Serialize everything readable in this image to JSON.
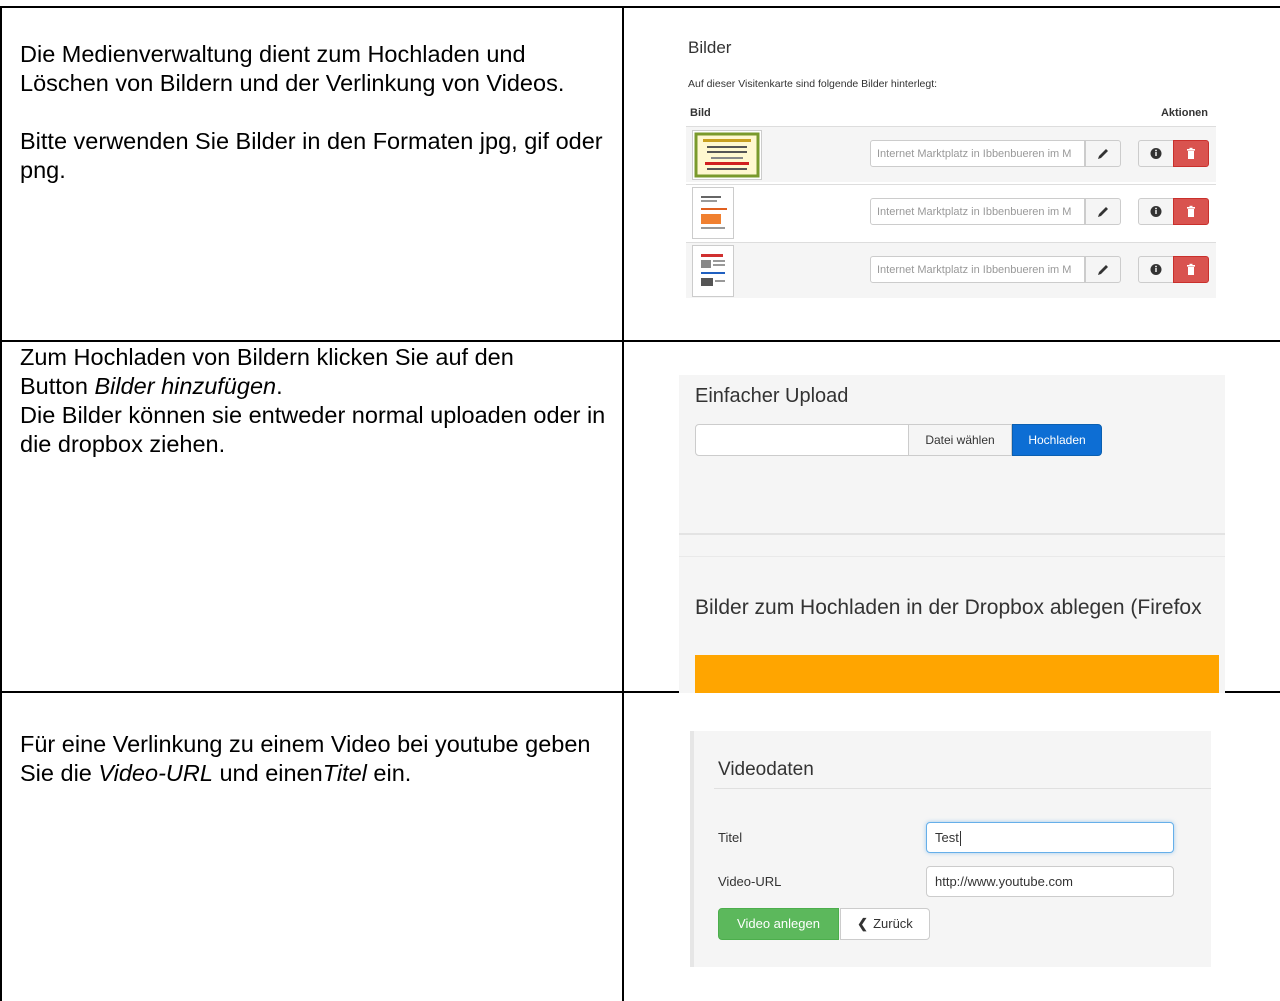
{
  "doc": {
    "row1": {
      "paragraph1": "Die Medienverwaltung dient zum Hochladen und Löschen von Bildern und der Verlinkung von Videos.",
      "paragraph2": "Bitte verwenden Sie Bilder in den Formaten jpg, gif oder png."
    },
    "row2": {
      "line1": "Zum Hochladen von Bildern klicken Sie auf den",
      "line2_prefix": "Button ",
      "line2_emph": "Bilder hinzufügen",
      "line2_suffix": ".",
      "line3": "Die Bilder können sie entweder normal uploaden oder in die dropbox ziehen."
    },
    "row3": {
      "text_prefix": "Für eine Verlinkung zu einem Video bei youtube geben Sie die ",
      "emph1": "Video-URL",
      "text_mid": " und einen",
      "emph2": "Titel",
      "text_suffix": " ein."
    }
  },
  "bilder_panel": {
    "title": "Bilder",
    "subtitle": "Auf dieser Visitenkarte sind folgende Bilder hinterlegt:",
    "col_bild": "Bild",
    "col_aktionen": "Aktionen",
    "rows": [
      {
        "caption": "Internet Marktplatz in Ibbenbueren im M"
      },
      {
        "caption": "Internet Marktplatz in Ibbenbueren im M"
      },
      {
        "caption": "Internet Marktplatz in Ibbenbueren im M"
      }
    ]
  },
  "upload_panel": {
    "heading": "Einfacher Upload",
    "choose_button": "Datei wählen",
    "upload_button": "Hochladen",
    "dropbox_heading": "Bilder zum Hochladen in der Dropbox ablegen (Firefox"
  },
  "video_panel": {
    "heading": "Videodaten",
    "title_label": "Titel",
    "title_value": "Test",
    "url_label": "Video-URL",
    "url_value": "http://www.youtube.com",
    "create_button": "Video anlegen",
    "back_button": "Zurück"
  },
  "colors": {
    "primary_blue": "#0d6ed4",
    "danger_red": "#d9534f",
    "success_green": "#5cb85c",
    "dropzone_orange": "#ffa500"
  }
}
